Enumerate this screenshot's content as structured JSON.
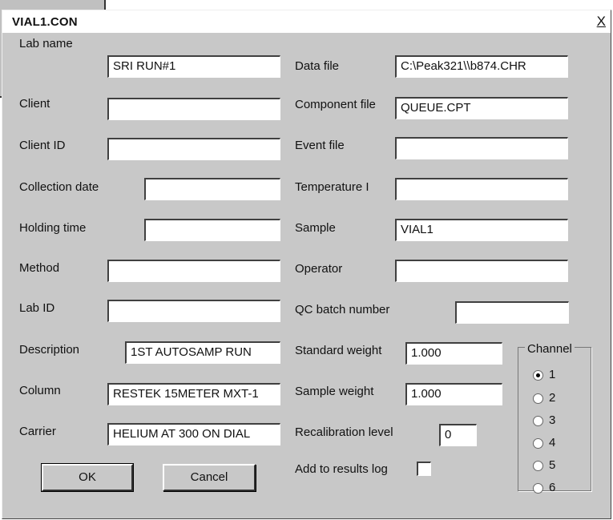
{
  "window": {
    "title": "VIAL1.CON",
    "close_glyph": "X"
  },
  "left_fields": [
    {
      "label": "Lab name",
      "value": "SRI RUN#1"
    },
    {
      "label": "Client",
      "value": ""
    },
    {
      "label": "Client ID",
      "value": ""
    },
    {
      "label": "Collection date",
      "value": ""
    },
    {
      "label": "Holding time",
      "value": ""
    },
    {
      "label": "Method",
      "value": ""
    },
    {
      "label": "Lab ID",
      "value": ""
    },
    {
      "label": "Description",
      "value": "1ST AUTOSAMP RUN"
    },
    {
      "label": "Column",
      "value": "RESTEK 15METER MXT-1"
    },
    {
      "label": "Carrier",
      "value": "HELIUM AT 300 ON DIAL"
    }
  ],
  "right_fields": [
    {
      "label": "Data file",
      "value": "C:\\Peak321\\\\b874.CHR"
    },
    {
      "label": "Component file",
      "value": "QUEUE.CPT"
    },
    {
      "label": "Event file",
      "value": ""
    },
    {
      "label": "Temperature I",
      "value": ""
    },
    {
      "label": "Sample",
      "value": "VIAL1"
    },
    {
      "label": "Operator",
      "value": ""
    },
    {
      "label": "QC batch number",
      "value": ""
    },
    {
      "label": "Standard weight",
      "value": "1.000"
    },
    {
      "label": "Sample weight",
      "value": "1.000"
    },
    {
      "label": "Recalibration level",
      "value": "0"
    },
    {
      "label": "Add to results log",
      "checked": false
    }
  ],
  "buttons": {
    "ok": "OK",
    "cancel": "Cancel"
  },
  "channel": {
    "title": "Channel",
    "options": [
      "1",
      "2",
      "3",
      "4",
      "5",
      "6"
    ],
    "selected": "1"
  }
}
